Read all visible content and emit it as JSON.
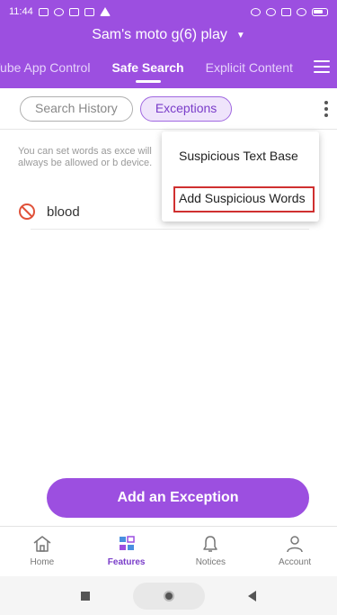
{
  "status_bar": {
    "time": "11:44"
  },
  "header": {
    "device_name": "Sam's moto g(6) play",
    "device_caret": "▼",
    "tabs": [
      {
        "label": "Tube App Control"
      },
      {
        "label": "Safe Search"
      },
      {
        "label": "Explicit Content"
      }
    ],
    "active_tab": "Safe Search"
  },
  "filter_chips": [
    {
      "label": "Search History"
    },
    {
      "label": "Exceptions"
    }
  ],
  "info_text": "You can set words as exce will always be allowed or b device.",
  "word_list": [
    {
      "word": "blood"
    }
  ],
  "popup_menu": [
    {
      "label": "Suspicious Text Base"
    },
    {
      "label": "Add Suspicious Words"
    }
  ],
  "primary_button": {
    "label": "Add an Exception"
  },
  "bottom_nav": [
    {
      "label": "Home",
      "icon": "home-icon"
    },
    {
      "label": "Features",
      "icon": "features-icon"
    },
    {
      "label": "Notices",
      "icon": "bell-icon"
    },
    {
      "label": "Account",
      "icon": "account-icon"
    }
  ],
  "colors": {
    "brand": "#9c4fe0",
    "highlight": "#d03030",
    "block_icon": "#e0523a"
  }
}
